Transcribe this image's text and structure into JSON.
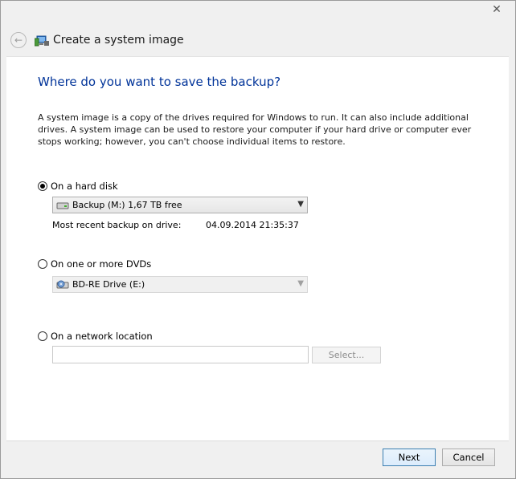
{
  "window": {
    "close_glyph": "✕"
  },
  "titlebar": {
    "back_icon": "back-arrow-icon",
    "app_icon": "backup-icon",
    "title": "Create a system image"
  },
  "main": {
    "heading": "Where do you want to save the backup?",
    "description": "A system image is a copy of the drives required for Windows to run. It can also include additional drives. A system image can be used to restore your computer if your hard drive or computer ever stops working; however, you can't choose individual items to restore.",
    "hard_disk": {
      "label": "On a hard disk",
      "selected": true,
      "drive": "Backup (M:)  1,67 TB free",
      "info_label": "Most recent backup on drive:",
      "info_value": "04.09.2014 21:35:37"
    },
    "dvd": {
      "label": "On one or more DVDs",
      "selected": false,
      "drive": "BD-RE Drive (E:)"
    },
    "network": {
      "label": "On a network location",
      "selected": false,
      "path_value": "",
      "select_label": "Select..."
    }
  },
  "footer": {
    "next_label": "Next",
    "cancel_label": "Cancel"
  },
  "colors": {
    "heading": "#003399",
    "primary_border": "#3c7fb1"
  }
}
